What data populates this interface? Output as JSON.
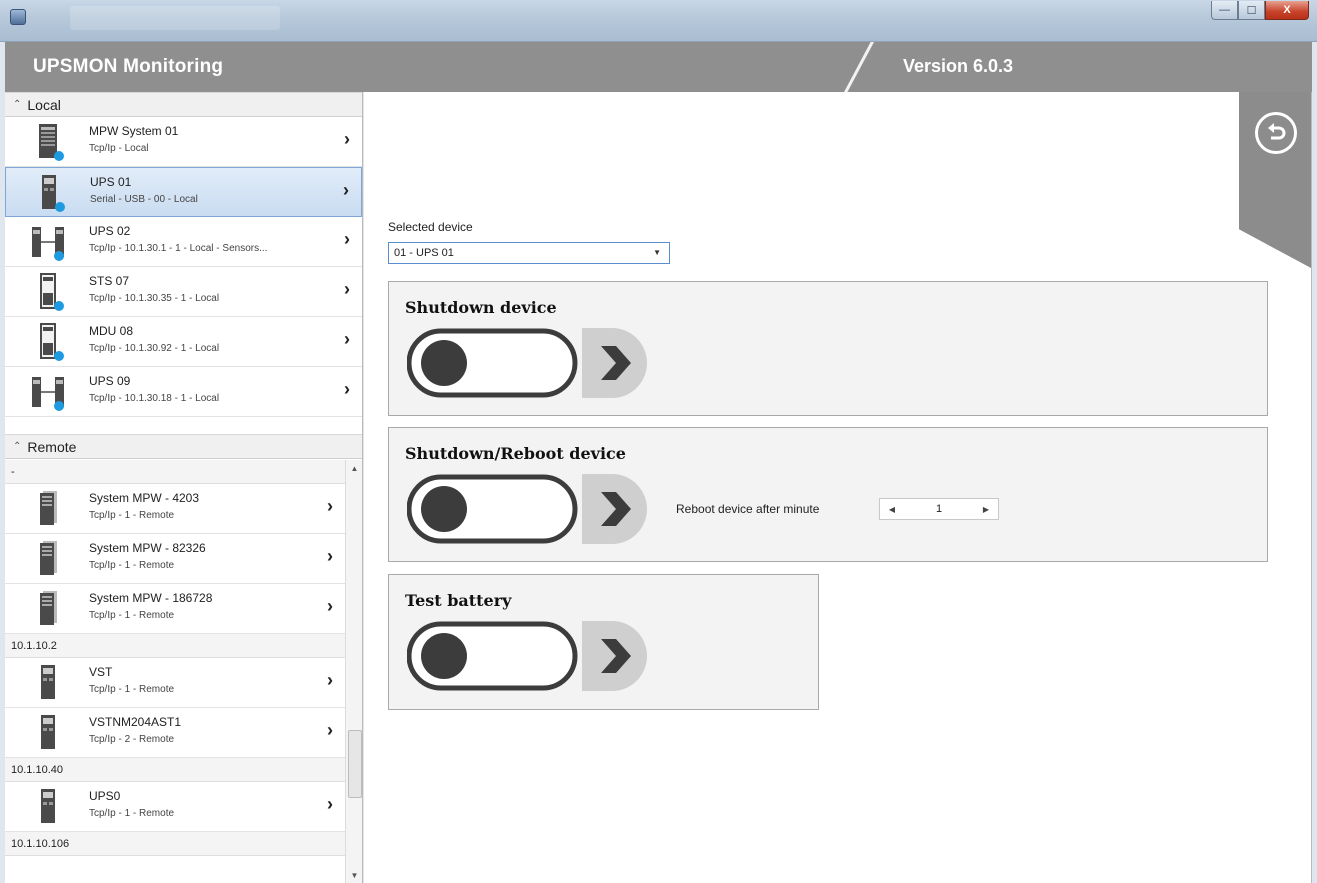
{
  "window": {
    "minimize": "—",
    "maximize": "☐",
    "close": "X"
  },
  "header": {
    "app_title": "UPSMON Monitoring",
    "version": "Version 6.0.3"
  },
  "sidebar": {
    "local_label": "Local",
    "remote_label": "Remote",
    "local_devices": [
      {
        "name": "MPW System 01",
        "sub": "Tcp/Ip - Local",
        "icon": "cabinet-icon",
        "selected": false
      },
      {
        "name": "UPS 01",
        "sub": "Serial - USB - 00 - Local",
        "icon": "ups-tower-icon",
        "selected": true
      },
      {
        "name": "UPS 02",
        "sub": "Tcp/Ip - 10.1.30.1 - 1 - Local - Sensors...",
        "icon": "ups-parallel-icon",
        "selected": false
      },
      {
        "name": "STS 07",
        "sub": "Tcp/Ip - 10.1.30.35 - 1 - Local",
        "icon": "sts-icon",
        "selected": false
      },
      {
        "name": "MDU 08",
        "sub": "Tcp/Ip - 10.1.30.92 - 1 - Local",
        "icon": "mdu-icon",
        "selected": false
      },
      {
        "name": "UPS 09",
        "sub": "Tcp/Ip - 10.1.30.18 - 1 - Local",
        "icon": "ups-parallel-icon",
        "selected": false
      }
    ],
    "remote_groups": [
      {
        "label": "-",
        "devices": [
          {
            "name": "System MPW -  4203",
            "sub": "Tcp/Ip - 1 - Remote"
          },
          {
            "name": "System MPW - 82326",
            "sub": "Tcp/Ip - 1 - Remote"
          },
          {
            "name": "System MPW - 186728",
            "sub": "Tcp/Ip - 1 - Remote"
          }
        ]
      },
      {
        "label": "10.1.10.2",
        "devices": [
          {
            "name": "VST",
            "sub": "Tcp/Ip - 1 - Remote"
          },
          {
            "name": "VSTNM204AST1",
            "sub": "Tcp/Ip - 2 - Remote"
          }
        ]
      },
      {
        "label": "10.1.10.40",
        "devices": [
          {
            "name": "UPS0",
            "sub": "Tcp/Ip - 1 - Remote"
          }
        ]
      },
      {
        "label": "10.1.10.106",
        "devices": []
      }
    ]
  },
  "main": {
    "selected_device_label": "Selected device",
    "selected_device_value": "01 - UPS 01",
    "panels": {
      "shutdown": "Shutdown device",
      "shutdown_reboot": "Shutdown/Reboot device",
      "test_battery": "Test battery"
    },
    "reboot_label": "Reboot device after minute",
    "reboot_minutes": "1"
  },
  "colors": {
    "header_bg": "#8f8f8f",
    "selection": "#c9dcf1",
    "status_dot": "#1e9be0"
  }
}
